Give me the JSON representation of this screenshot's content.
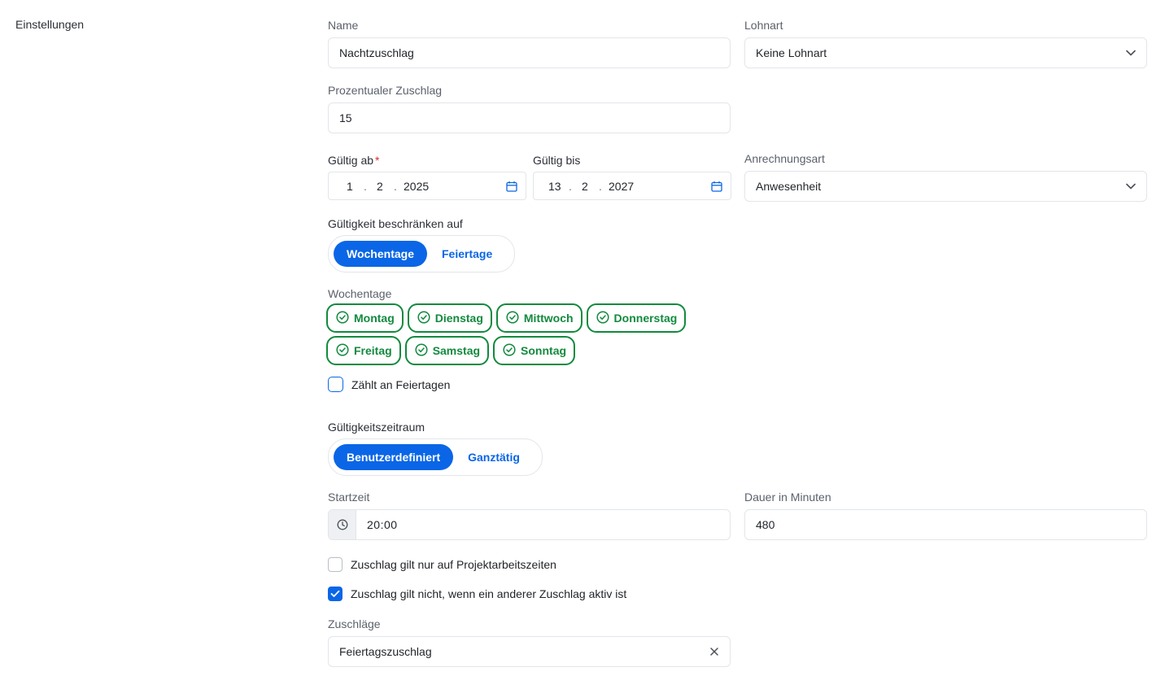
{
  "section": {
    "label": "Einstellungen"
  },
  "name": {
    "label": "Name",
    "value": "Nachtzuschlag"
  },
  "lohnart": {
    "label": "Lohnart",
    "value": "Keine Lohnart"
  },
  "prozent": {
    "label": "Prozentualer Zuschlag",
    "value": "15"
  },
  "gueltig_ab": {
    "label": "Gültig ab",
    "required": "*",
    "day": "1",
    "month": "2",
    "year": "2025"
  },
  "gueltig_bis": {
    "label": "Gültig bis",
    "day": "13",
    "month": "2",
    "year": "2027"
  },
  "date_separator": ".",
  "anrechnungsart": {
    "label": "Anrechnungsart",
    "value": "Anwesenheit"
  },
  "beschraenkung": {
    "label": "Gültigkeit beschränken auf",
    "options": [
      "Wochentage",
      "Feiertage"
    ],
    "selected": "Wochentage"
  },
  "wochentage": {
    "label": "Wochentage",
    "row1": [
      "Montag",
      "Dienstag",
      "Mittwoch",
      "Donnerstag"
    ],
    "row2": [
      "Freitag",
      "Samstag",
      "Sonntag"
    ],
    "checked_color": "#128a3e"
  },
  "feiertage_cb": {
    "label": "Zählt an Feiertagen",
    "checked": false
  },
  "zeitraum": {
    "label": "Gültigkeitszeitraum",
    "options": [
      "Benutzerdefiniert",
      "Ganztätig"
    ],
    "selected": "Benutzerdefiniert"
  },
  "startzeit": {
    "label": "Startzeit",
    "value": "20:00"
  },
  "dauer": {
    "label": "Dauer in Minuten",
    "value": "480"
  },
  "projekt_cb": {
    "label": "Zuschlag gilt nur auf Projektarbeitszeiten",
    "checked": false
  },
  "anderer_cb": {
    "label": "Zuschlag gilt nicht, wenn ein anderer Zuschlag aktiv ist",
    "checked": true
  },
  "zuschlaege": {
    "label": "Zuschläge",
    "value": "Feiertagszuschlag"
  },
  "colors": {
    "accent": "#0a66e6",
    "success": "#128a3e",
    "required": "#d32f2f"
  }
}
